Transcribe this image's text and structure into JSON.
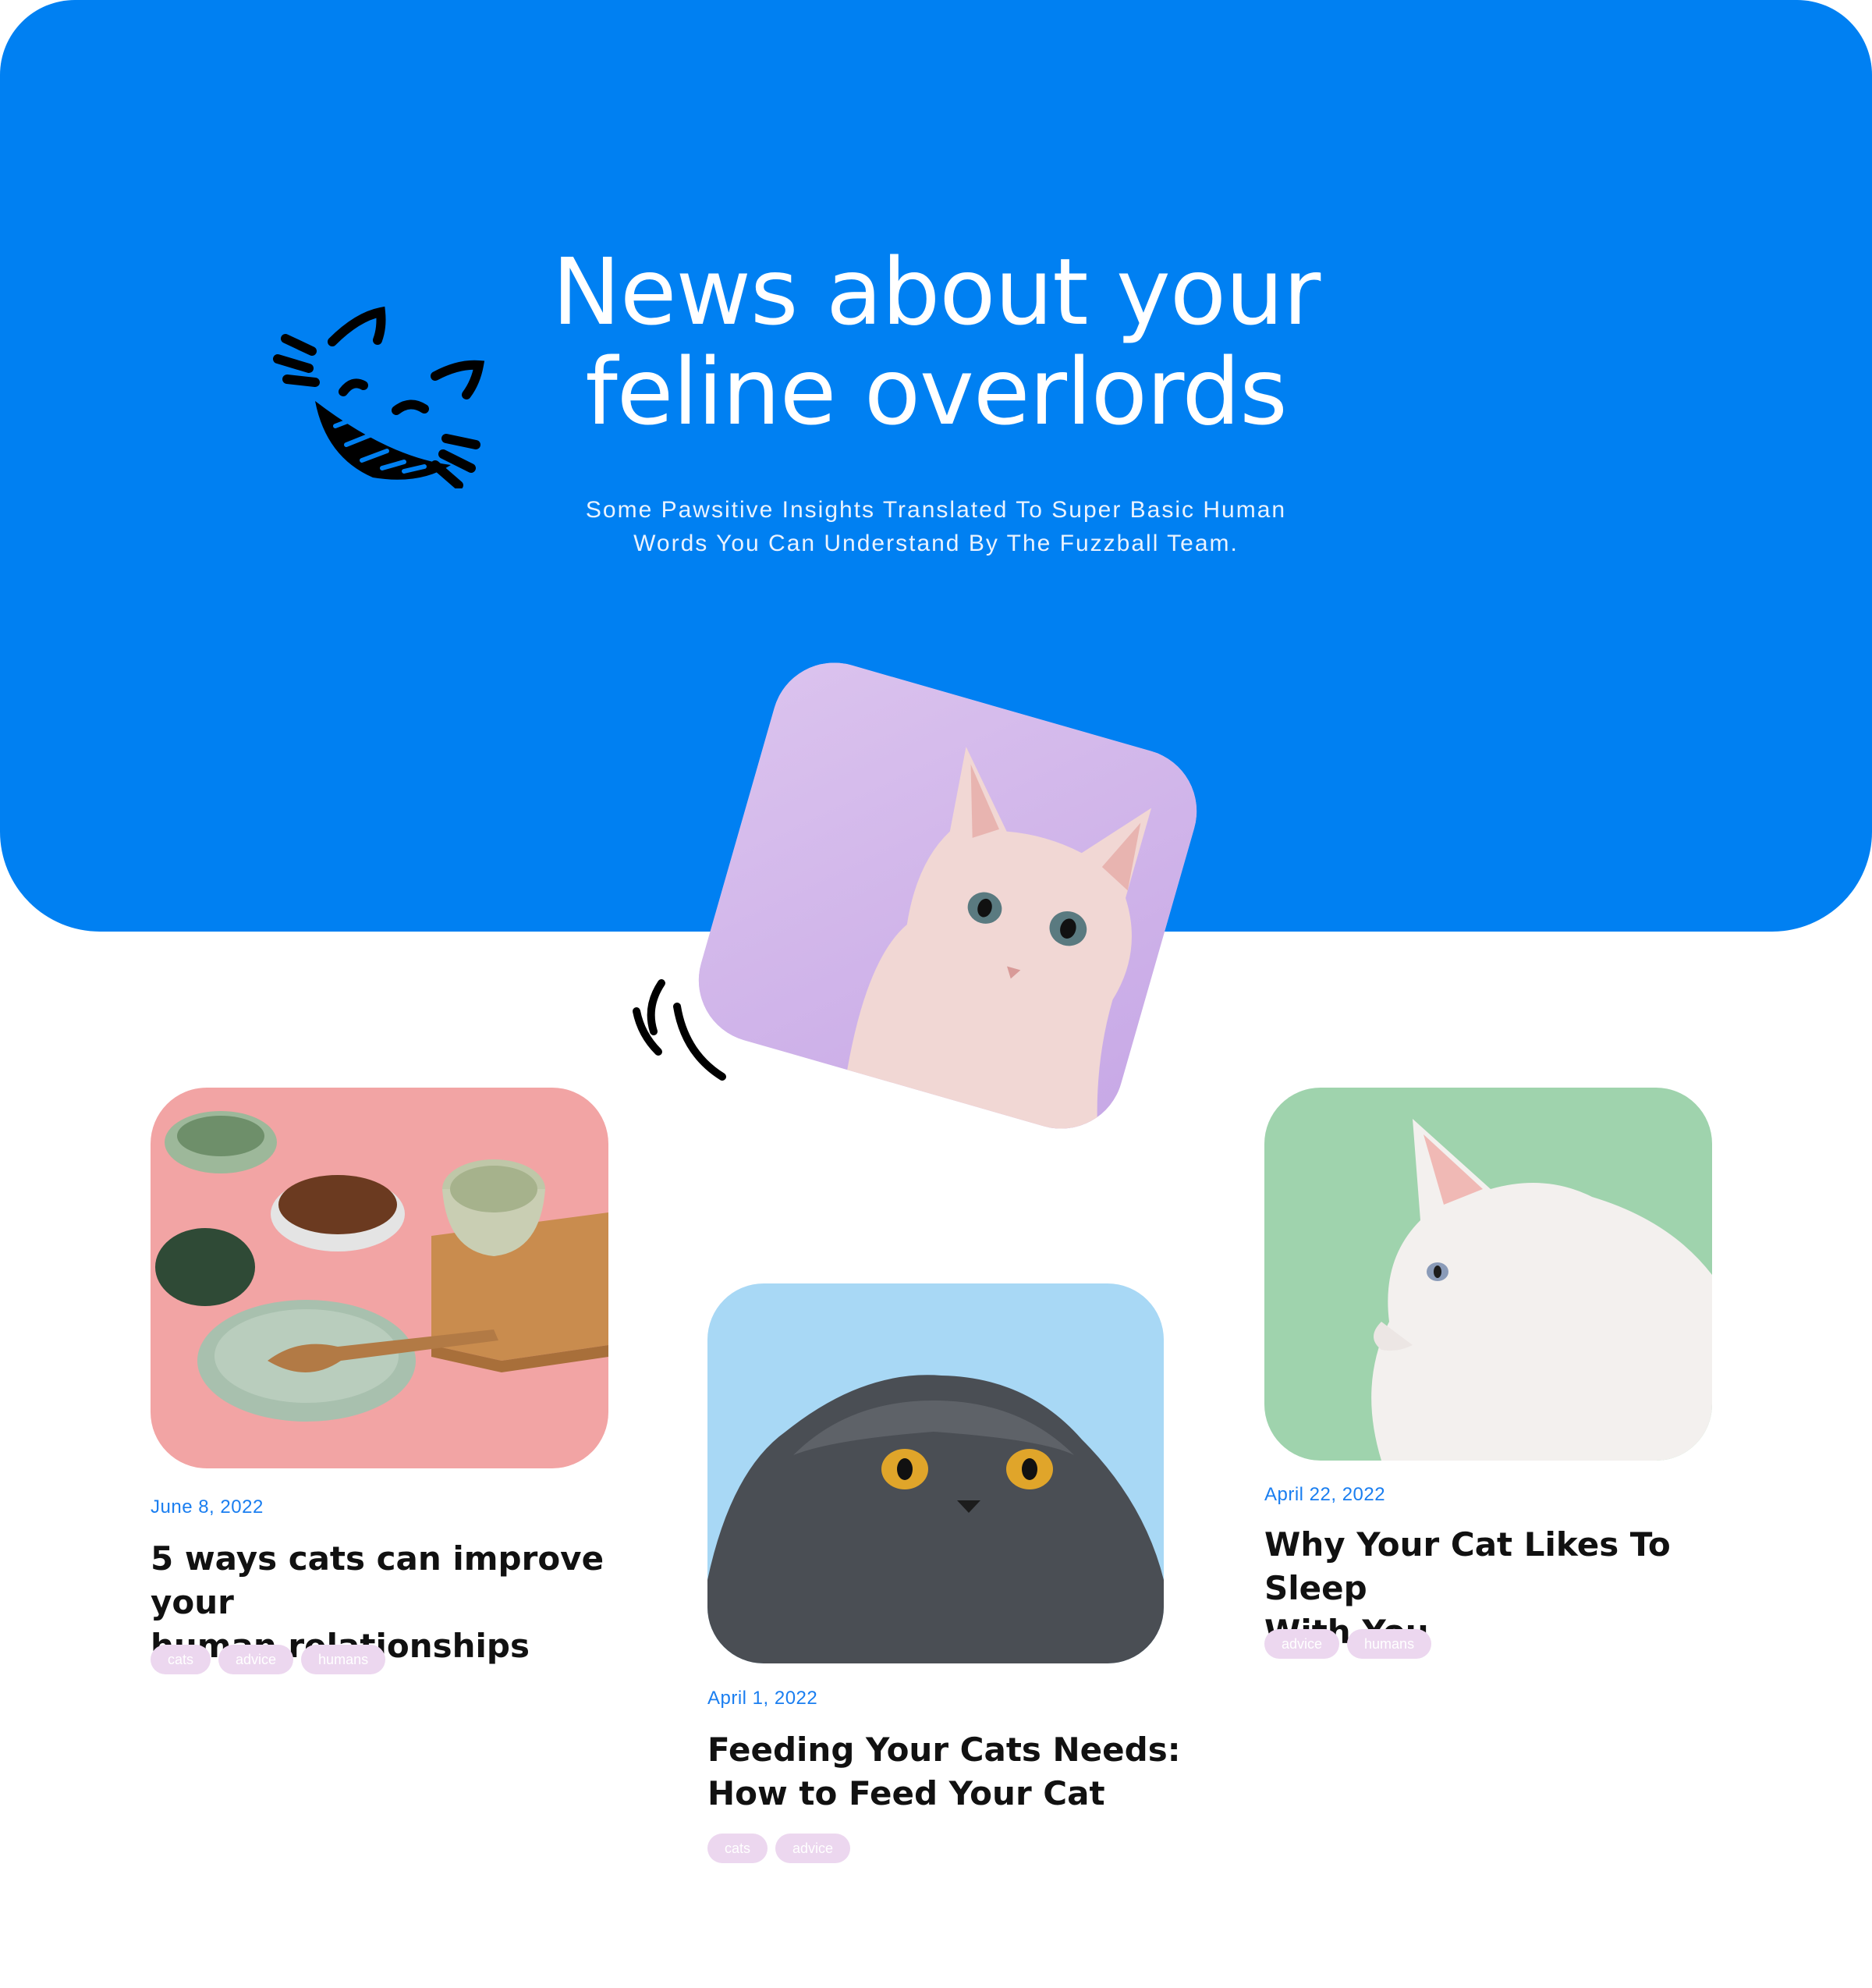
{
  "hero": {
    "title_line1": "News about your",
    "title_line2": "feline overlords",
    "subtitle_line1": "Some Pawsitive Insights Translated To Super Basic Human",
    "subtitle_line2": "Words You Can Understand By The Fuzzball Team."
  },
  "colors": {
    "hero_bg": "#0080f2",
    "date": "#1a7ef0",
    "tag_bg": "#ecd7ef"
  },
  "posts": [
    {
      "date": "June 8, 2022",
      "title_line1": "5 ways cats can improve your",
      "title_line2": "human relationships",
      "tags": [
        "cats",
        "advice",
        "humans"
      ],
      "image": "cat-bowls-and-spoon-on-pink"
    },
    {
      "date": "April 1, 2022",
      "title_line1": "Feeding Your Cats Needs:",
      "title_line2": "How to Feed Your Cat",
      "tags": [
        "cats",
        "advice"
      ],
      "image": "grey-cat-looking-up-on-blue"
    },
    {
      "date": "April 22, 2022",
      "title_line1": "Why Your Cat Likes To Sleep",
      "title_line2": "With You",
      "tags": [
        "advice",
        "humans"
      ],
      "image": "white-fluffy-cat-on-green"
    }
  ],
  "feature_image": "sphynx-cat-on-lavender"
}
